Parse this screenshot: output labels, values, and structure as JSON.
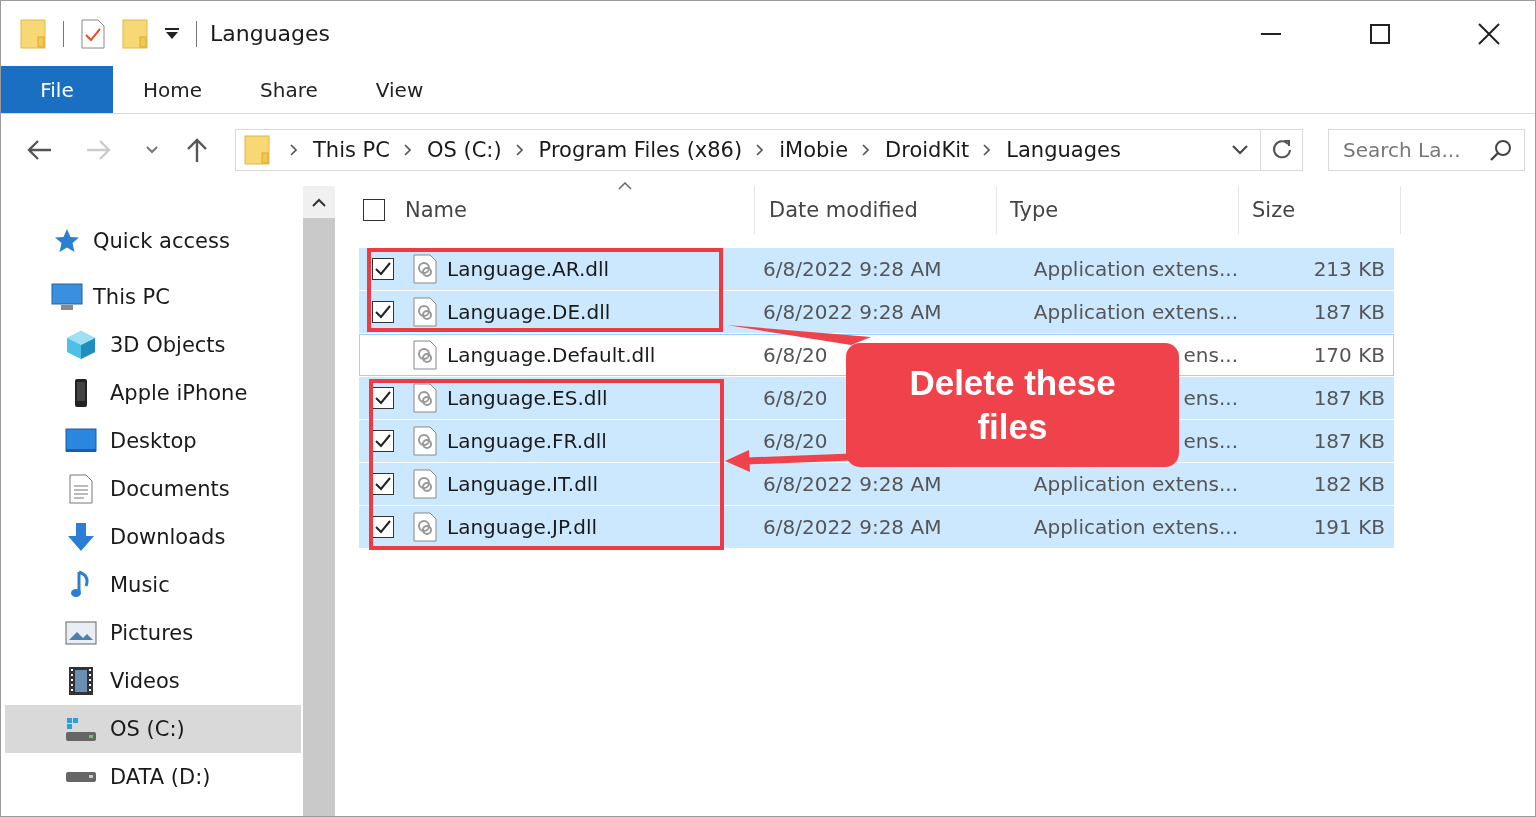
{
  "window": {
    "title": "Languages"
  },
  "ribbon": {
    "tabs": [
      {
        "label": "File",
        "kind": "file"
      },
      {
        "label": "Home",
        "kind": "tab"
      },
      {
        "label": "Share",
        "kind": "tab"
      },
      {
        "label": "View",
        "kind": "tab"
      }
    ]
  },
  "address_bar": {
    "breadcrumbs": [
      "This PC",
      "OS (C:)",
      "Program Files (x86)",
      "iMobie",
      "DroidKit",
      "Languages"
    ]
  },
  "search": {
    "placeholder": "Search La..."
  },
  "sidebar": {
    "items": [
      {
        "label": "Quick access",
        "kind": "star",
        "selected": false
      },
      {
        "label": "This PC",
        "kind": "computer",
        "selected": false,
        "children": [
          {
            "label": "3D Objects",
            "kind": "cube",
            "selected": false
          },
          {
            "label": "Apple iPhone",
            "kind": "phone",
            "selected": false
          },
          {
            "label": "Desktop",
            "kind": "desktop",
            "selected": false
          },
          {
            "label": "Documents",
            "kind": "document",
            "selected": false
          },
          {
            "label": "Downloads",
            "kind": "download",
            "selected": false
          },
          {
            "label": "Music",
            "kind": "music",
            "selected": false
          },
          {
            "label": "Pictures",
            "kind": "picture",
            "selected": false
          },
          {
            "label": "Videos",
            "kind": "video",
            "selected": false
          },
          {
            "label": "OS (C:)",
            "kind": "drive",
            "selected": true
          },
          {
            "label": "DATA (D:)",
            "kind": "disk",
            "selected": false
          }
        ]
      }
    ]
  },
  "file_list": {
    "select_all": {
      "checked": false
    },
    "columns": [
      {
        "label": "Name"
      },
      {
        "label": "Date modified"
      },
      {
        "label": "Type"
      },
      {
        "label": "Size"
      }
    ],
    "rows": [
      {
        "name": "Language.AR.dll",
        "date_modified": "6/8/2022 9:28 AM",
        "type": "Application extens...",
        "size": "213 KB",
        "selected": true,
        "checked": true,
        "focused": false
      },
      {
        "name": "Language.DE.dll",
        "date_modified": "6/8/2022 9:28 AM",
        "type": "Application extens...",
        "size": "187 KB",
        "selected": true,
        "checked": true,
        "focused": false
      },
      {
        "name": "Language.Default.dll",
        "date_modified": "6/8/20",
        "type": "ens...",
        "size": "170 KB",
        "selected": false,
        "checked": false,
        "focused": true
      },
      {
        "name": "Language.ES.dll",
        "date_modified": "6/8/20",
        "type": "ens...",
        "size": "187 KB",
        "selected": true,
        "checked": true,
        "focused": false
      },
      {
        "name": "Language.FR.dll",
        "date_modified": "6/8/20",
        "type": "ens...",
        "size": "187 KB",
        "selected": true,
        "checked": true,
        "focused": false
      },
      {
        "name": "Language.IT.dll",
        "date_modified": "6/8/2022 9:28 AM",
        "type": "Application extens...",
        "size": "182 KB",
        "selected": true,
        "checked": true,
        "focused": false
      },
      {
        "name": "Language.JP.dll",
        "date_modified": "6/8/2022 9:28 AM",
        "type": "Application extens...",
        "size": "191 KB",
        "selected": true,
        "checked": true,
        "focused": false
      }
    ]
  },
  "annotation": {
    "callout": "Delete these files"
  }
}
